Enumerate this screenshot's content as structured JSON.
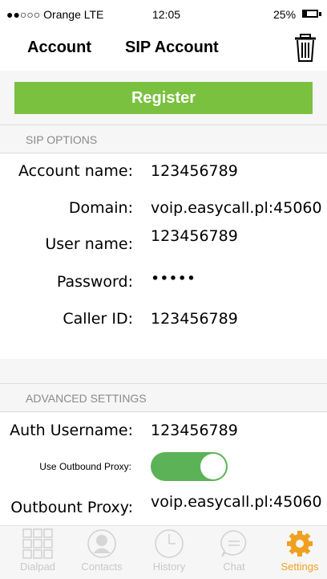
{
  "status_bar": {
    "carrier": "●●○○○ Orange LTE",
    "time": "12:05",
    "battery_percent": "25%"
  },
  "header": {
    "back_label": "Account",
    "title": "SIP Account"
  },
  "register_button": "Register",
  "sip_options": {
    "section_title": "SIP OPTIONS",
    "account_name_label": "Account name:",
    "account_name_value": "123456789",
    "domain_label": "Domain:",
    "domain_value": "voip.easycall.pl:45060",
    "user_name_label": "User name:",
    "user_name_value": "123456789",
    "password_label": "Password:",
    "password_value": "•••••",
    "caller_id_label": "Caller ID:",
    "caller_id_value": "123456789"
  },
  "advanced": {
    "section_title": "ADVANCED SETTINGS",
    "auth_username_label": "Auth Username:",
    "auth_username_value": "123456789",
    "outbound_proxy_toggle_label": "Use Outbound Proxy:",
    "outbound_proxy_enabled": true,
    "outbound_proxy_label": "Outbount Proxy:",
    "outbound_proxy_value": "voip.easycall.pl:45060"
  },
  "tabs": [
    {
      "label": "Dialpad",
      "icon": "dialpad-icon"
    },
    {
      "label": "Contacts",
      "icon": "contacts-icon"
    },
    {
      "label": "History",
      "icon": "history-icon"
    },
    {
      "label": "Chat",
      "icon": "chat-icon"
    },
    {
      "label": "Settings",
      "icon": "settings-icon",
      "active": true
    }
  ],
  "colors": {
    "accent_green": "#79c13f",
    "toggle_green": "#5cb357",
    "active_tab": "#f0a020",
    "inactive_tab": "#c8c8c8"
  }
}
